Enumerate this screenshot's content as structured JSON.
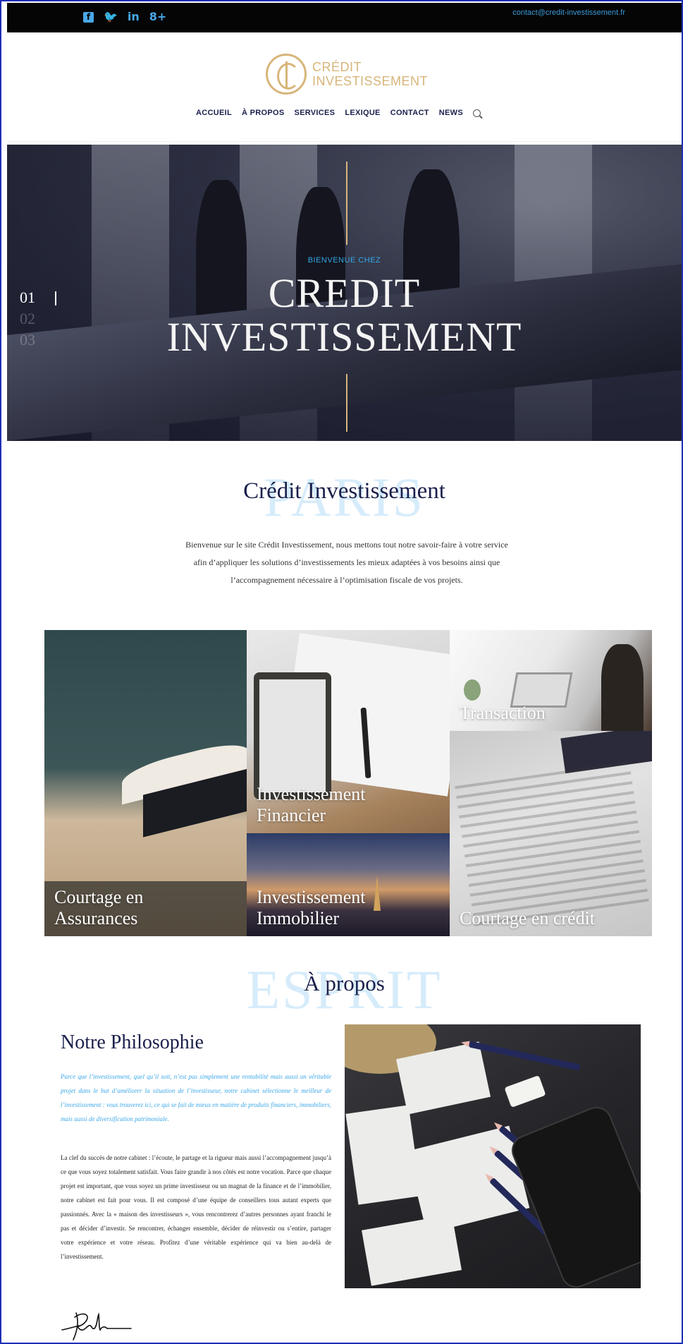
{
  "topbar": {
    "social": [
      {
        "name": "facebook-icon",
        "glyph": "f"
      },
      {
        "name": "twitter-icon",
        "glyph": "🐦"
      },
      {
        "name": "linkedin-icon",
        "glyph": "in"
      },
      {
        "name": "googleplus-icon",
        "glyph": "8+"
      }
    ],
    "email": "contact@credit-investissement.fr"
  },
  "header": {
    "logo_line1": "CRÉDIT",
    "logo_line2": "INVESTISSEMENT",
    "nav": [
      "ACCUEIL",
      "À PROPOS",
      "SERVICES",
      "LEXIQUE",
      "CONTACT",
      "NEWS"
    ]
  },
  "hero": {
    "welcome": "BIENVENUE CHEZ",
    "title_line1": "CREDIT",
    "title_line2": "INVESTISSEMENT",
    "slides": [
      "01",
      "02",
      "03"
    ]
  },
  "intro": {
    "ghost": "PARIS",
    "title": "Crédit Investissement",
    "text": "Bienvenue sur le site Crédit Investissement, nous mettons tout notre savoir-faire à votre service afin d’appliquer les solutions d’investissements les mieux adaptées à vos besoins ainsi que l’accompagnement nécessaire à l’optimisation fiscale de vos projets."
  },
  "services": [
    {
      "id": "courtage-assurances",
      "label": "Courtage en Assurances"
    },
    {
      "id": "investissement-financier",
      "label": "Investissement Financier"
    },
    {
      "id": "transaction",
      "label": "Transaction"
    },
    {
      "id": "investissement-immobilier",
      "label": "Investissement Immobilier"
    },
    {
      "id": "courtage-credit",
      "label": "Courtage en crédit"
    }
  ],
  "about": {
    "ghost": "ESPRIT",
    "title": "À propos",
    "subtitle": "Notre Philosophie",
    "quote": "Parce que l’investissement, quel qu’il soit, n’est pas simplement une rentabilité mais aussi un véritable projet dans le but d’améliorer la situation de l’investisseur, notre cabinet sélectionne le meilleur de l’investissement : vous trouverez ici, ce qui se fait de mieux en matière de produits financiers, immobiliers, mais aussi de diversification patrimoniale.",
    "body": "La clef du succès de notre cabinet : l’écoute, le partage et la rigueur mais aussi l’accompagnement jusqu’à ce que vous soyez totalement satisfait. Vous faire grandir à nos côtés est notre vocation. Parce que chaque projet est important, que vous soyez un prime investisseur ou un magnat de la finance et de l’immobilier, notre cabinet est fait pour vous. Il est composé d’une équipe de conseillers tous autant experts que passionnés. Avec la « maison des investisseurs », vous rencontrerez d’autres personnes ayant franchi le pas et décider d’investir. Se rencontrer, échanger ensemble, décider de réinvestir ou s’entire, partager votre expérience et votre réseau. Profitez d’une véritable expérience qui va bien au-delà de l’investissement."
  }
}
